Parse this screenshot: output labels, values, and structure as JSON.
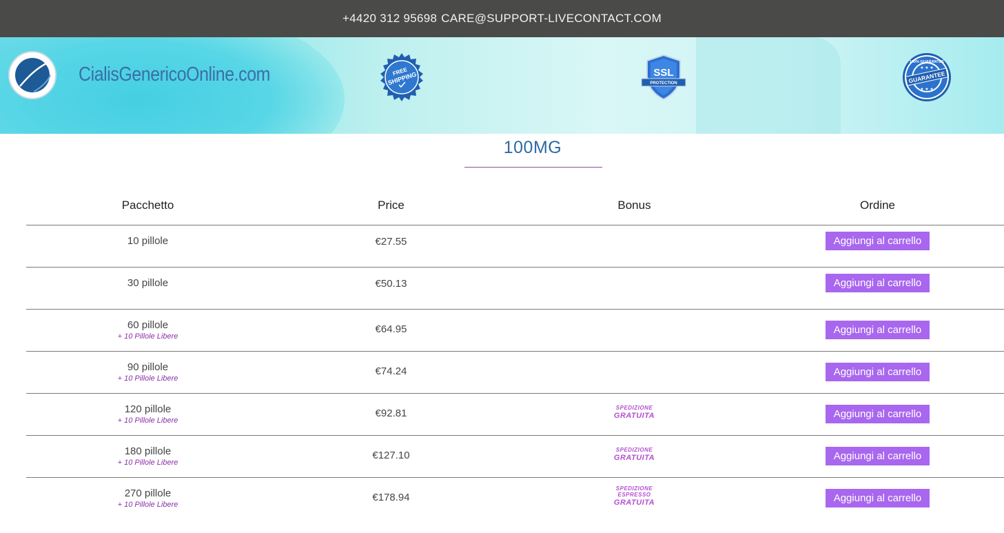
{
  "topbar": {
    "phone": "+4420 312 95698",
    "email": "CARE@SUPPORT-LIVECONTACT.COM"
  },
  "header": {
    "site_name": "CialisGenericoOnline.com",
    "badges": {
      "shipping_top": "FREE",
      "shipping_main": "SHIPPING",
      "ssl_main": "SSL",
      "ssl_sub": "PROTECTION",
      "guarantee_ring": "100% GUARANTEE",
      "guarantee_main": "GUARANTEE"
    }
  },
  "section": {
    "title": "100MG"
  },
  "table": {
    "headers": {
      "package": "Pacchetto",
      "price": "Price",
      "bonus": "Bonus",
      "order": "Ordine"
    },
    "button_label": "Aggiungi al carrello",
    "rows": [
      {
        "package": "10 pillole",
        "extra": "",
        "price": "€27.55",
        "bonus_small": "",
        "bonus_small2": "",
        "bonus_big": ""
      },
      {
        "package": "30 pillole",
        "extra": "",
        "price": "€50.13",
        "bonus_small": "",
        "bonus_small2": "",
        "bonus_big": ""
      },
      {
        "package": "60 pillole",
        "extra": "+ 10 Pillole Libere",
        "price": "€64.95",
        "bonus_small": "",
        "bonus_small2": "",
        "bonus_big": ""
      },
      {
        "package": "90 pillole",
        "extra": "+ 10 Pillole Libere",
        "price": "€74.24",
        "bonus_small": "",
        "bonus_small2": "",
        "bonus_big": ""
      },
      {
        "package": "120 pillole",
        "extra": "+ 10 Pillole Libere",
        "price": "€92.81",
        "bonus_small": "SPEDIZIONE",
        "bonus_small2": "",
        "bonus_big": "GRATUITA"
      },
      {
        "package": "180 pillole",
        "extra": "+ 10 Pillole Libere",
        "price": "€127.10",
        "bonus_small": "SPEDIZIONE",
        "bonus_small2": "",
        "bonus_big": "GRATUITA"
      },
      {
        "package": "270 pillole",
        "extra": "+ 10 Pillole Libere",
        "price": "€178.94",
        "bonus_small": "SPEDIZIONE",
        "bonus_small2": "ESPRESSO",
        "bonus_big": "GRATUITA"
      }
    ]
  }
}
